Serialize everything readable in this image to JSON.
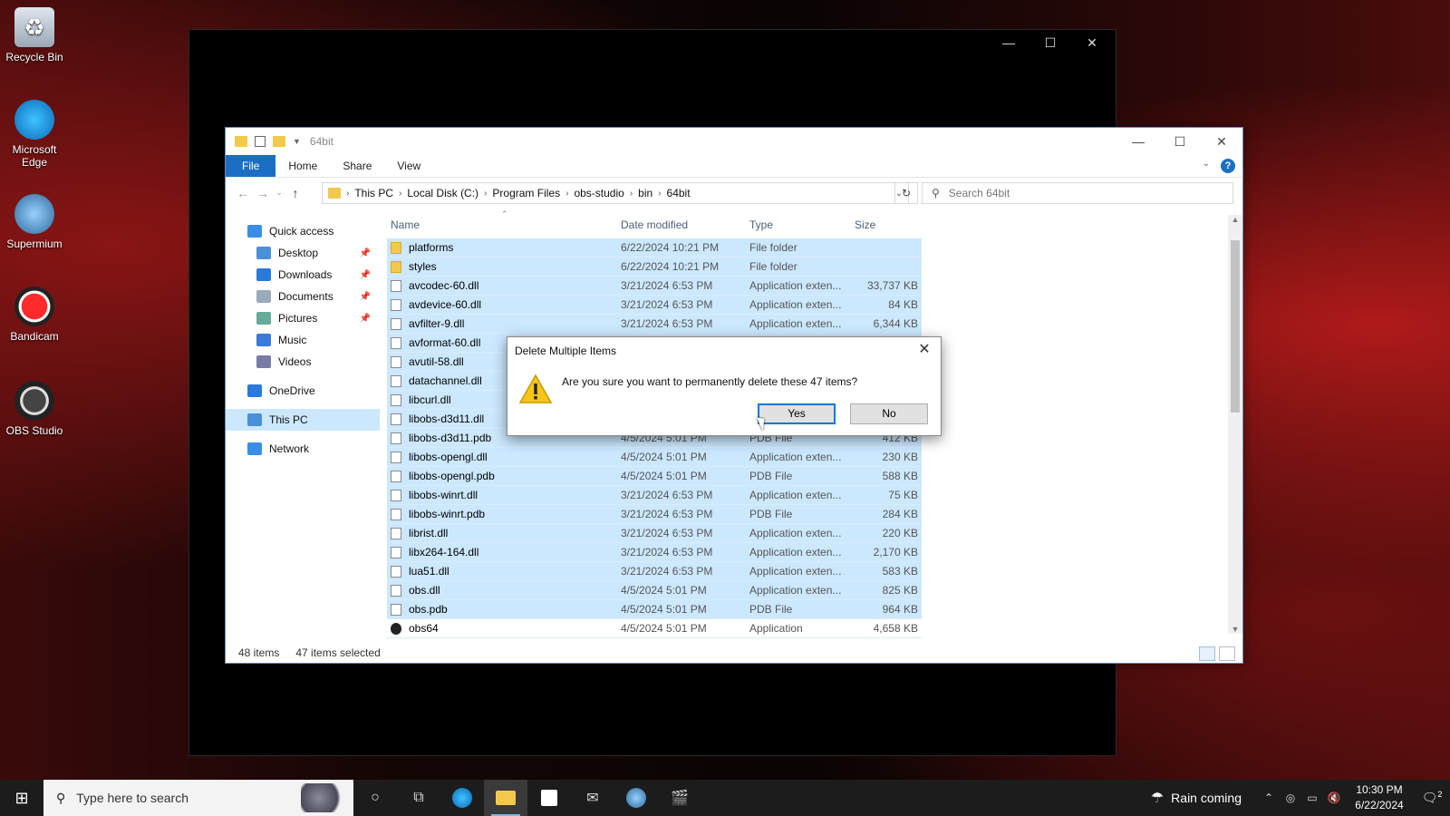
{
  "desktop": {
    "icons": [
      {
        "label": "Recycle Bin",
        "icon": "recycle-bin-icon"
      },
      {
        "label": "Microsoft Edge",
        "icon": "edge-icon"
      },
      {
        "label": "Supermium",
        "icon": "supermium-icon"
      },
      {
        "label": "Bandicam",
        "icon": "bandicam-icon"
      },
      {
        "label": "OBS Studio",
        "icon": "obs-icon"
      }
    ]
  },
  "explorer": {
    "title": "64bit",
    "ribbon_tabs": [
      "File",
      "Home",
      "Share",
      "View"
    ],
    "breadcrumb": [
      "This PC",
      "Local Disk (C:)",
      "Program Files",
      "obs-studio",
      "bin",
      "64bit"
    ],
    "search_placeholder": "Search 64bit",
    "nav": [
      {
        "label": "Quick access",
        "icon": "star-icon",
        "pinned": false,
        "level": 0
      },
      {
        "label": "Desktop",
        "icon": "desktop-icon",
        "pinned": true,
        "level": 1
      },
      {
        "label": "Downloads",
        "icon": "downloads-icon",
        "pinned": true,
        "level": 1
      },
      {
        "label": "Documents",
        "icon": "documents-icon",
        "pinned": true,
        "level": 1
      },
      {
        "label": "Pictures",
        "icon": "pictures-icon",
        "pinned": true,
        "level": 1
      },
      {
        "label": "Music",
        "icon": "music-icon",
        "pinned": false,
        "level": 1
      },
      {
        "label": "Videos",
        "icon": "videos-icon",
        "pinned": false,
        "level": 1
      },
      {
        "label": "OneDrive",
        "icon": "onedrive-icon",
        "pinned": false,
        "level": 0
      },
      {
        "label": "This PC",
        "icon": "this-pc-icon",
        "pinned": false,
        "level": 0,
        "selected": true
      },
      {
        "label": "Network",
        "icon": "network-icon",
        "pinned": false,
        "level": 0
      }
    ],
    "columns": {
      "name": "Name",
      "date": "Date modified",
      "type": "Type",
      "size": "Size"
    },
    "files": [
      {
        "name": "platforms",
        "date": "6/22/2024 10:21 PM",
        "type": "File folder",
        "size": "",
        "kind": "folder"
      },
      {
        "name": "styles",
        "date": "6/22/2024 10:21 PM",
        "type": "File folder",
        "size": "",
        "kind": "folder"
      },
      {
        "name": "avcodec-60.dll",
        "date": "3/21/2024 6:53 PM",
        "type": "Application exten...",
        "size": "33,737 KB",
        "kind": "dll"
      },
      {
        "name": "avdevice-60.dll",
        "date": "3/21/2024 6:53 PM",
        "type": "Application exten...",
        "size": "84 KB",
        "kind": "dll"
      },
      {
        "name": "avfilter-9.dll",
        "date": "3/21/2024 6:53 PM",
        "type": "Application exten...",
        "size": "6,344 KB",
        "kind": "dll"
      },
      {
        "name": "avformat-60.dll",
        "date": "",
        "type": "",
        "size": "",
        "kind": "dll"
      },
      {
        "name": "avutil-58.dll",
        "date": "",
        "type": "",
        "size": "",
        "kind": "dll"
      },
      {
        "name": "datachannel.dll",
        "date": "",
        "type": "",
        "size": "",
        "kind": "dll"
      },
      {
        "name": "libcurl.dll",
        "date": "",
        "type": "",
        "size": "",
        "kind": "dll"
      },
      {
        "name": "libobs-d3d11.dll",
        "date": "",
        "type": "",
        "size": "",
        "kind": "dll"
      },
      {
        "name": "libobs-d3d11.pdb",
        "date": "4/5/2024 5:01 PM",
        "type": "PDB File",
        "size": "412 KB",
        "kind": "pdb"
      },
      {
        "name": "libobs-opengl.dll",
        "date": "4/5/2024 5:01 PM",
        "type": "Application exten...",
        "size": "230 KB",
        "kind": "dll"
      },
      {
        "name": "libobs-opengl.pdb",
        "date": "4/5/2024 5:01 PM",
        "type": "PDB File",
        "size": "588 KB",
        "kind": "pdb"
      },
      {
        "name": "libobs-winrt.dll",
        "date": "3/21/2024 6:53 PM",
        "type": "Application exten...",
        "size": "75 KB",
        "kind": "dll"
      },
      {
        "name": "libobs-winrt.pdb",
        "date": "3/21/2024 6:53 PM",
        "type": "PDB File",
        "size": "284 KB",
        "kind": "pdb"
      },
      {
        "name": "librist.dll",
        "date": "3/21/2024 6:53 PM",
        "type": "Application exten...",
        "size": "220 KB",
        "kind": "dll"
      },
      {
        "name": "libx264-164.dll",
        "date": "3/21/2024 6:53 PM",
        "type": "Application exten...",
        "size": "2,170 KB",
        "kind": "dll"
      },
      {
        "name": "lua51.dll",
        "date": "3/21/2024 6:53 PM",
        "type": "Application exten...",
        "size": "583 KB",
        "kind": "dll"
      },
      {
        "name": "obs.dll",
        "date": "4/5/2024 5:01 PM",
        "type": "Application exten...",
        "size": "825 KB",
        "kind": "dll"
      },
      {
        "name": "obs.pdb",
        "date": "4/5/2024 5:01 PM",
        "type": "PDB File",
        "size": "964 KB",
        "kind": "pdb"
      },
      {
        "name": "obs64",
        "date": "4/5/2024 5:01 PM",
        "type": "Application",
        "size": "4,658 KB",
        "kind": "app",
        "selected": false
      }
    ],
    "status": {
      "count": "48 items",
      "selected": "47 items selected"
    }
  },
  "dialog": {
    "title": "Delete Multiple Items",
    "message": "Are you sure you want to permanently delete these 47 items?",
    "yes": "Yes",
    "no": "No"
  },
  "taskbar": {
    "search_placeholder": "Type here to search",
    "weather": "Rain coming",
    "time": "10:30 PM",
    "date": "6/22/2024",
    "notifications": "2"
  },
  "colors": {
    "accent": "#0078d7",
    "selection": "#cce8ff",
    "file_tab": "#1a6fc4"
  }
}
